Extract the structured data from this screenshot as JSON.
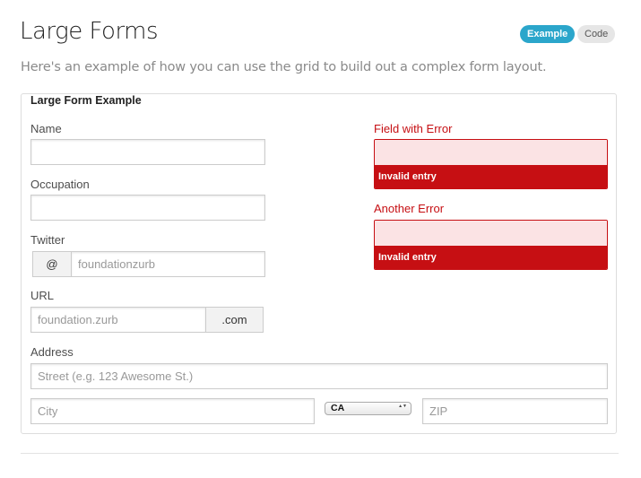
{
  "header": {
    "title": "Large Forms",
    "subtitle": "Here's an example of how you can use the grid to build out a complex form layout.",
    "tabs": [
      {
        "label": "Example",
        "active": true
      },
      {
        "label": "Code",
        "active": false
      }
    ]
  },
  "form": {
    "legend": "Large Form Example",
    "name": {
      "label": "Name",
      "value": "",
      "placeholder": ""
    },
    "occupation": {
      "label": "Occupation",
      "value": "",
      "placeholder": ""
    },
    "twitter": {
      "label": "Twitter",
      "prefix": "@",
      "placeholder": "foundationzurb"
    },
    "url": {
      "label": "URL",
      "placeholder": "foundation.zurb",
      "postfix": ".com"
    },
    "error_field_1": {
      "label": "Field with Error",
      "message": "Invalid entry"
    },
    "error_field_2": {
      "label": "Another Error",
      "message": "Invalid entry"
    },
    "address": {
      "label": "Address",
      "street_placeholder": "Street (e.g. 123 Awesome St.)",
      "city_placeholder": "City",
      "state_selected": "CA",
      "zip_placeholder": "ZIP"
    }
  },
  "colors": {
    "accent": "#2ba6cb",
    "error": "#c60f13",
    "error_bg": "#fbe3e4"
  }
}
